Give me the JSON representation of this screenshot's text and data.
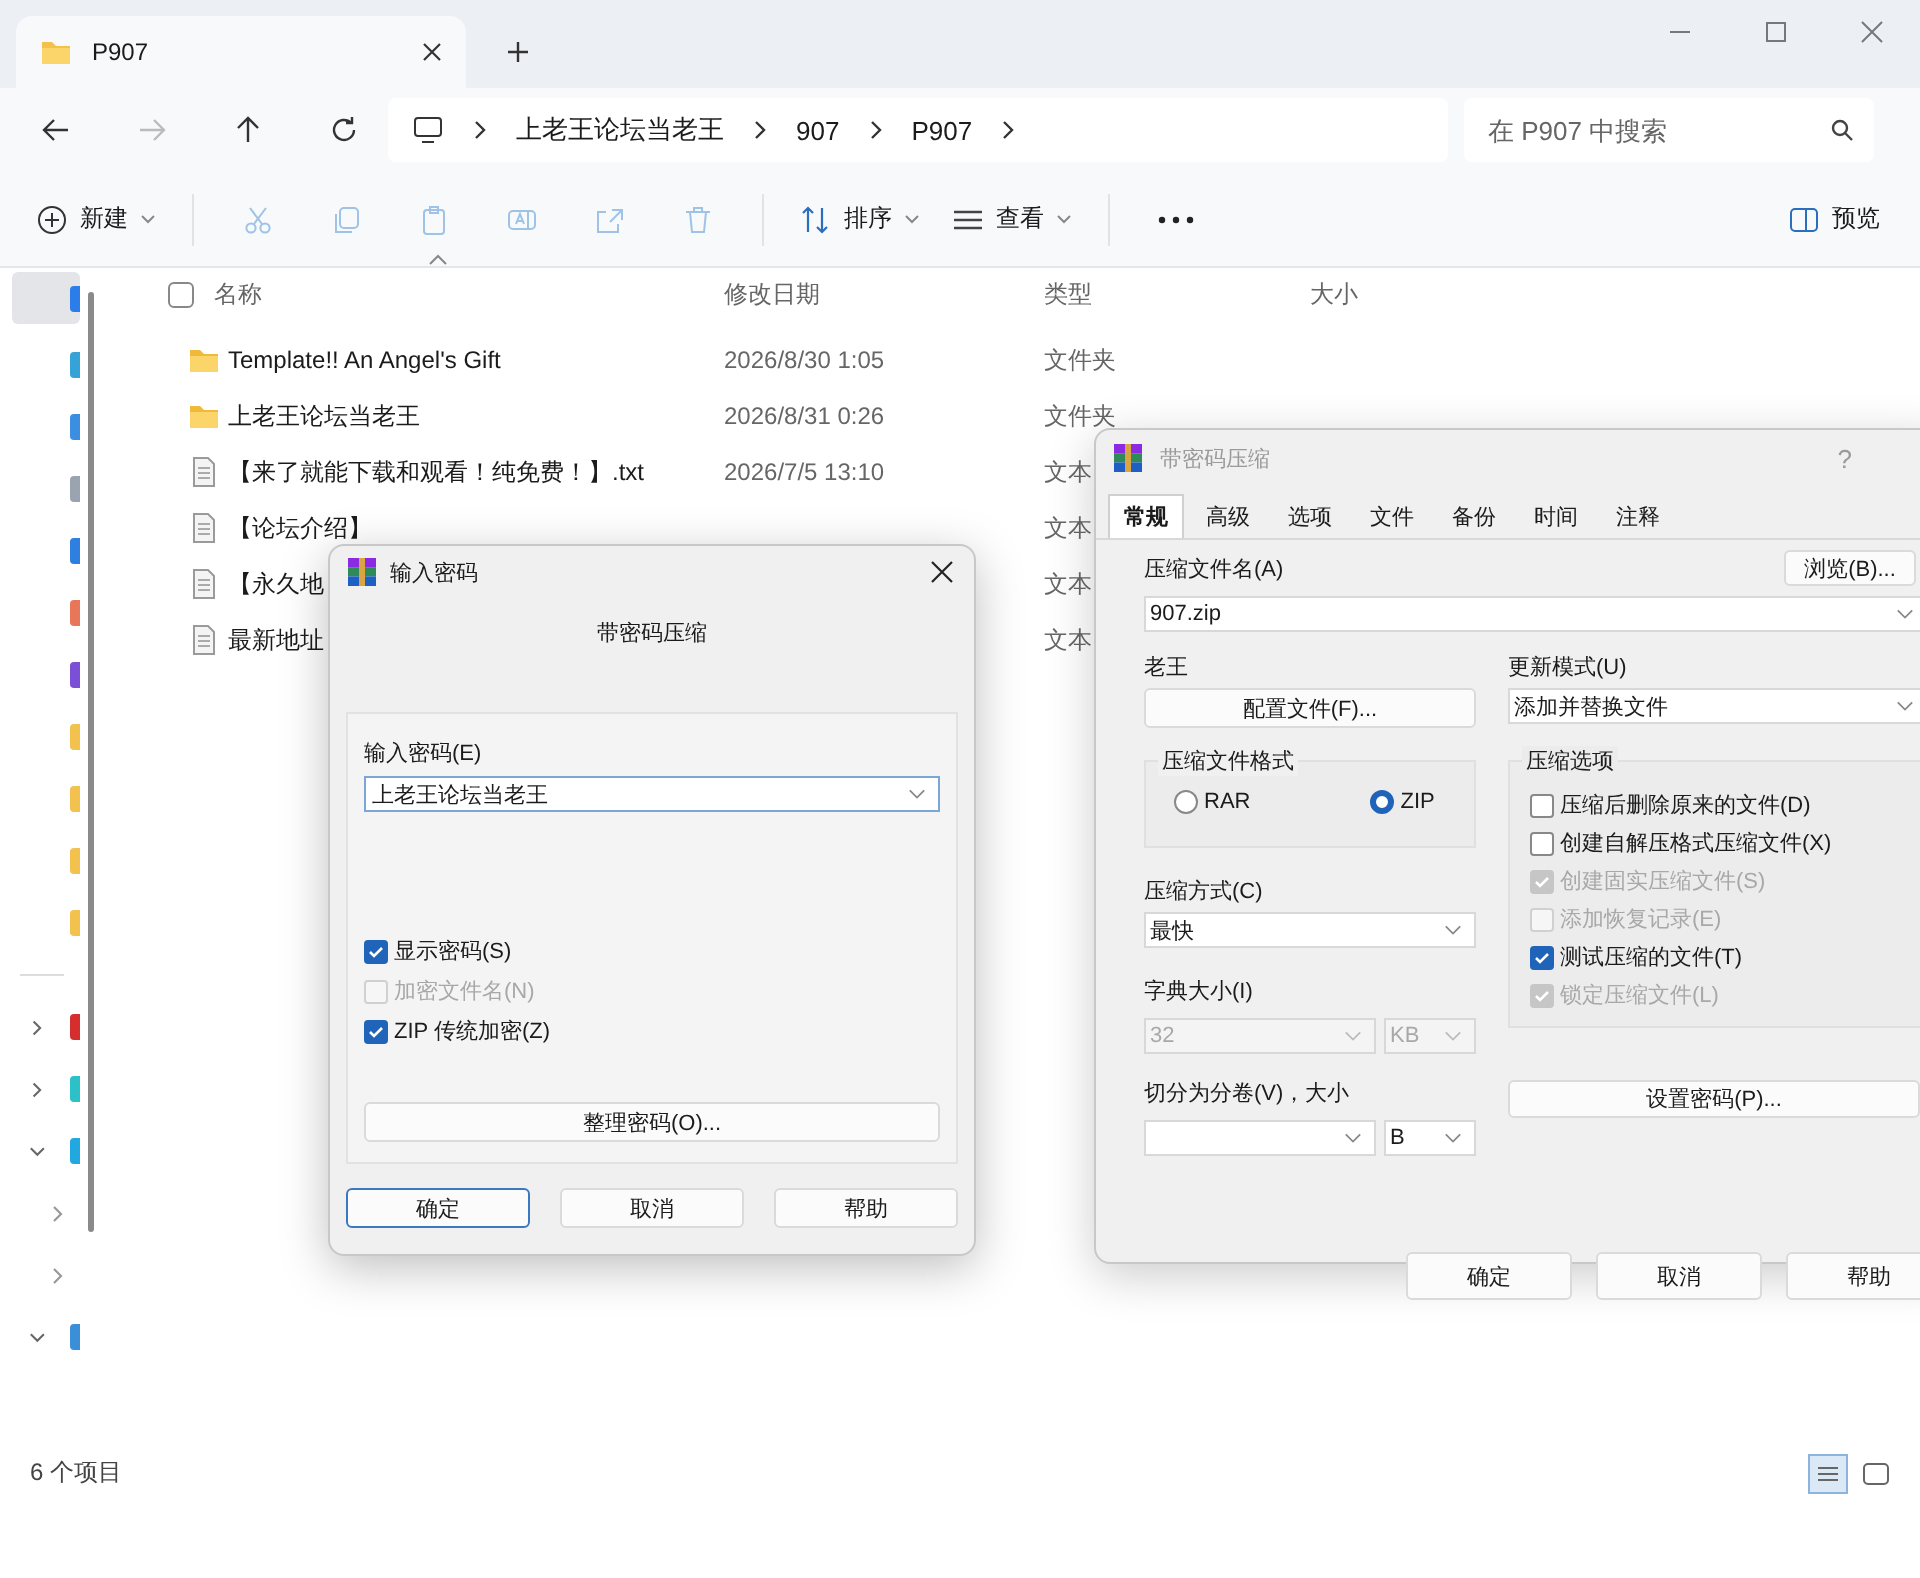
{
  "tab": {
    "title": "P907"
  },
  "address": {
    "breadcrumb": [
      "上老王论坛当老王",
      "907",
      "P907"
    ],
    "search": {
      "placeholder": "在 P907 中搜索"
    }
  },
  "toolbar": {
    "new": "新建",
    "sort": "排序",
    "view": "查看",
    "preview": "预览"
  },
  "sidebar": {
    "items": [
      {
        "color": "#2b7de9",
        "selected": true
      },
      {
        "color": "#35a3d8",
        "selected": false
      },
      {
        "color": "#3b8ee0",
        "selected": false
      },
      {
        "color": "#9aa4b0",
        "selected": false
      },
      {
        "color": "#2f7fe0",
        "selected": false
      },
      {
        "color": "#e8775a",
        "selected": false
      },
      {
        "color": "#7b4fd6",
        "selected": false
      },
      {
        "color": "#f2c14e",
        "selected": false
      },
      {
        "color": "#f2c14e",
        "selected": false
      },
      {
        "color": "#f2c14e",
        "selected": false
      },
      {
        "color": "#f2c14e",
        "selected": false
      }
    ],
    "tree": [
      {
        "color": "#d62d2d",
        "expanded": false
      },
      {
        "color": "#2cc0c8",
        "expanded": false
      },
      {
        "color": "#22a8e0",
        "expanded": true,
        "children": [
          {
            "expanded": false
          },
          {
            "expanded": false
          }
        ]
      },
      {
        "color": "#3a8fd8",
        "expanded": true
      }
    ]
  },
  "columns": [
    "名称",
    "修改日期",
    "类型",
    "大小"
  ],
  "select_all": {
    "checked": false
  },
  "files": [
    {
      "kind": "folder",
      "name": "Template!! An Angel's Gift",
      "modified": "2026/8/30 1:05",
      "type": "文件夹"
    },
    {
      "kind": "folder",
      "name": "上老王论坛当老王",
      "modified": "2026/8/31 0:26",
      "type": "文件夹"
    },
    {
      "kind": "text",
      "name": "【来了就能下载和观看！纯免费！】.txt",
      "modified": "2026/7/5 13:10",
      "type": "文本"
    },
    {
      "kind": "text",
      "name": "【论坛介绍】",
      "type": "文本"
    },
    {
      "kind": "text",
      "name": "【永久地",
      "type": "文本"
    },
    {
      "kind": "text",
      "name": "最新地址",
      "type": "文本"
    }
  ],
  "status_bar": {
    "count": "6 个项目"
  },
  "password_dialog": {
    "title": "输入密码",
    "subtitle": "带密码压缩",
    "password_label": "输入密码(E)",
    "password": "上老王论坛当老王",
    "options": [
      {
        "label": "显示密码(S)",
        "checked": true,
        "disabled": false
      },
      {
        "label": "加密文件名(N)",
        "checked": false,
        "disabled": true
      },
      {
        "label": "ZIP 传统加密(Z)",
        "checked": true,
        "disabled": false
      }
    ],
    "organize": "整理密码(O)...",
    "buttons": [
      {
        "label": "确定",
        "selected": true
      },
      {
        "label": "取消",
        "selected": false
      },
      {
        "label": "帮助",
        "selected": false
      }
    ]
  },
  "archive_dialog": {
    "title": "带密码压缩",
    "help": "?",
    "tabs": [
      {
        "label": "常规",
        "selected": true
      },
      {
        "label": "高级",
        "selected": false
      },
      {
        "label": "选项",
        "selected": false
      },
      {
        "label": "文件",
        "selected": false
      },
      {
        "label": "备份",
        "selected": false
      },
      {
        "label": "时间",
        "selected": false
      },
      {
        "label": "注释",
        "selected": false
      }
    ],
    "name_label": "压缩文件名(A)",
    "browse": "浏览(B)...",
    "name": "907.zip",
    "profile_label": "老王",
    "profile_button": "配置文件(F)...",
    "update_label": "更新模式(U)",
    "update": "添加并替换文件",
    "format_label": "压缩文件格式",
    "formats": [
      {
        "label": "RAR",
        "selected": false
      },
      {
        "label": "ZIP",
        "selected": true
      }
    ],
    "method_label": "压缩方式(C)",
    "method": "最快",
    "dict_label": "字典大小(I)",
    "dict": "32",
    "dict_unit": "KB",
    "split_label": "切分为分卷(V)，大小",
    "split_unit": "B",
    "options_label": "压缩选项",
    "options": [
      {
        "label": "压缩后删除原来的文件(D)",
        "checked": false,
        "disabled": false
      },
      {
        "label": "创建自解压格式压缩文件(X)",
        "checked": false,
        "disabled": false
      },
      {
        "label": "创建固实压缩文件(S)",
        "checked": true,
        "disabled": true
      },
      {
        "label": "添加恢复记录(E)",
        "checked": false,
        "disabled": true
      },
      {
        "label": "测试压缩的文件(T)",
        "checked": true,
        "disabled": false
      },
      {
        "label": "锁定压缩文件(L)",
        "checked": true,
        "disabled": true
      }
    ],
    "set_password": "设置密码(P)...",
    "buttons": [
      {
        "label": "确定"
      },
      {
        "label": "取消"
      },
      {
        "label": "帮助"
      }
    ]
  }
}
